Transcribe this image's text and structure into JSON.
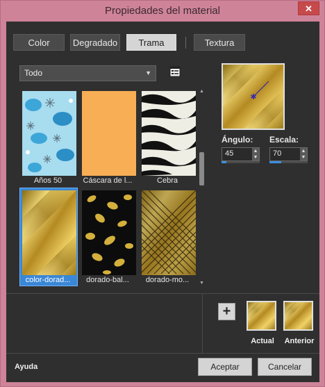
{
  "window": {
    "title": "Propiedades del material",
    "close_glyph": "✕"
  },
  "tabs": [
    {
      "label": "Color",
      "active": false
    },
    {
      "label": "Degradado",
      "active": false
    },
    {
      "label": "Trama",
      "active": true
    },
    {
      "label": "Textura",
      "active": false
    }
  ],
  "category_select": {
    "value": "Todo",
    "arrow": "▼"
  },
  "library_icon": "library-icon",
  "patterns": [
    {
      "label": "Años 50",
      "selected": false,
      "kind": "retro"
    },
    {
      "label": "Cáscara de l...",
      "selected": false,
      "kind": "peel"
    },
    {
      "label": "Cebra",
      "selected": false,
      "kind": "zebra"
    },
    {
      "label": "color-dorad...",
      "selected": true,
      "kind": "gold"
    },
    {
      "label": "dorado-bal...",
      "selected": false,
      "kind": "gold-floral"
    },
    {
      "label": "dorado-mo...",
      "selected": false,
      "kind": "gold-mesh"
    }
  ],
  "scrollbar": {
    "up": "▲",
    "down": "▼"
  },
  "preview": {
    "angle_label": "Ángulo:",
    "angle_value": "45",
    "angle_fraction": 0.125,
    "scale_label": "Escala:",
    "scale_value": "70",
    "scale_fraction": 0.3
  },
  "spinner": {
    "up": "▲",
    "down": "▼"
  },
  "add_button": "+",
  "swatches": {
    "current_label": "Actual",
    "previous_label": "Anterior"
  },
  "footer": {
    "help": "Ayuda",
    "accept": "Aceptar",
    "cancel": "Cancelar"
  },
  "colors": {
    "selection": "#3a87d6",
    "gold": "#d8b542",
    "accent": "#3c8fe0"
  }
}
